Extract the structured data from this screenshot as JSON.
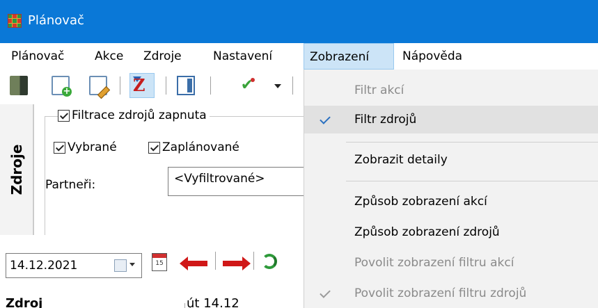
{
  "window": {
    "title": "Plánovač"
  },
  "menubar": [
    {
      "label": "Plánovač"
    },
    {
      "label": "Akce"
    },
    {
      "label": "Zdroje"
    },
    {
      "label": "Nastavení"
    },
    {
      "label": "Zobrazení"
    },
    {
      "label": "Nápověda"
    }
  ],
  "toolbar": {
    "icons": [
      "exit-icon",
      "new-document-icon",
      "edit-document-icon",
      "filter-icon",
      "panel-icon",
      "check-icon",
      "dropdown-arrow-icon"
    ]
  },
  "side_tab": {
    "label": "Zdroje"
  },
  "filter": {
    "enabled_label": "Filtrace zdrojů zapnuta",
    "enabled": true,
    "selected_label": "Vybrané",
    "selected": true,
    "planned_label": "Zaplánované",
    "planned": true,
    "partners_label": "Partneři:",
    "partners_value": "<Vyfiltrované>"
  },
  "datebar": {
    "date_value": "14.12.2021",
    "icons": [
      "calendar-icon",
      "today-calendar-icon",
      "previous-arrow-icon",
      "next-arrow-icon",
      "refresh-icon"
    ]
  },
  "bottom_row": {
    "col_a": "Zdroj",
    "col_b": "út 14.12"
  },
  "dropdown": {
    "items": [
      {
        "label": "Filtr akcí",
        "disabled": true,
        "checked": false
      },
      {
        "label": "Filtr zdrojů",
        "disabled": false,
        "checked": true
      },
      {
        "label": "Zobrazit detaily",
        "disabled": false,
        "checked": false
      },
      {
        "label": "Způsob zobrazení akcí",
        "disabled": false,
        "checked": false
      },
      {
        "label": "Způsob zobrazení zdrojů",
        "disabled": false,
        "checked": false
      },
      {
        "label": "Povolit zobrazení filtru akcí",
        "disabled": true,
        "checked": false
      },
      {
        "label": "Povolit zobrazení filtru zdrojů",
        "disabled": true,
        "checked": true
      }
    ]
  },
  "colors": {
    "titlebar": "#0a78d7",
    "menu_active": "#cce4f7",
    "menu_bg": "#f2f2f2",
    "disabled_text": "#8a8a8a"
  }
}
